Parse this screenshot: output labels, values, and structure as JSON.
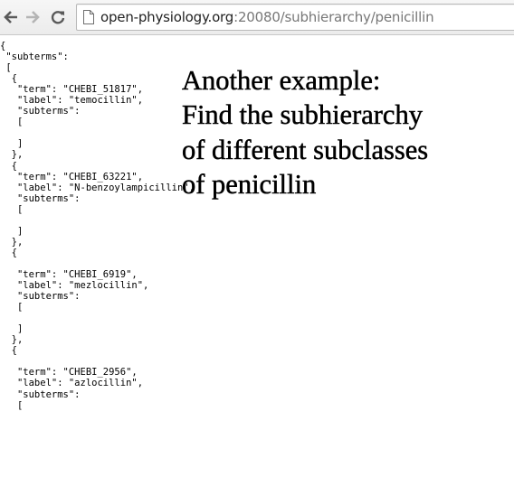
{
  "browser": {
    "url_host": "open-physiology.org",
    "url_rest": ":20080/subhierarchy/penicillin",
    "icons": {
      "back": "back-arrow-icon",
      "forward": "forward-arrow-icon",
      "reload": "reload-icon",
      "page": "page-icon"
    },
    "colors": {
      "url_host": "#222222",
      "url_rest": "#777777"
    }
  },
  "json_lines": [
    "{",
    " \"subterms\":",
    " [",
    "  {",
    "   \"term\": \"CHEBI_51817\",",
    "   \"label\": \"temocillin\",",
    "   \"subterms\":",
    "   [",
    "",
    "   ]",
    "  },",
    "  {",
    "   \"term\": \"CHEBI_63221\",",
    "   \"label\": \"N-benzoylampicillin\",",
    "   \"subterms\":",
    "   [",
    "",
    "   ]",
    "  },",
    "  {",
    "",
    "   \"term\": \"CHEBI_6919\",",
    "   \"label\": \"mezlocillin\",",
    "   \"subterms\":",
    "   [",
    "",
    "   ]",
    "  },",
    "  {",
    "",
    "   \"term\": \"CHEBI_2956\",",
    "   \"label\": \"azlocillin\",",
    "   \"subterms\":",
    "   ["
  ],
  "overlay": {
    "lines": [
      "Another example:",
      "Find the subhierarchy",
      "of different subclasses",
      "of penicillin"
    ]
  }
}
